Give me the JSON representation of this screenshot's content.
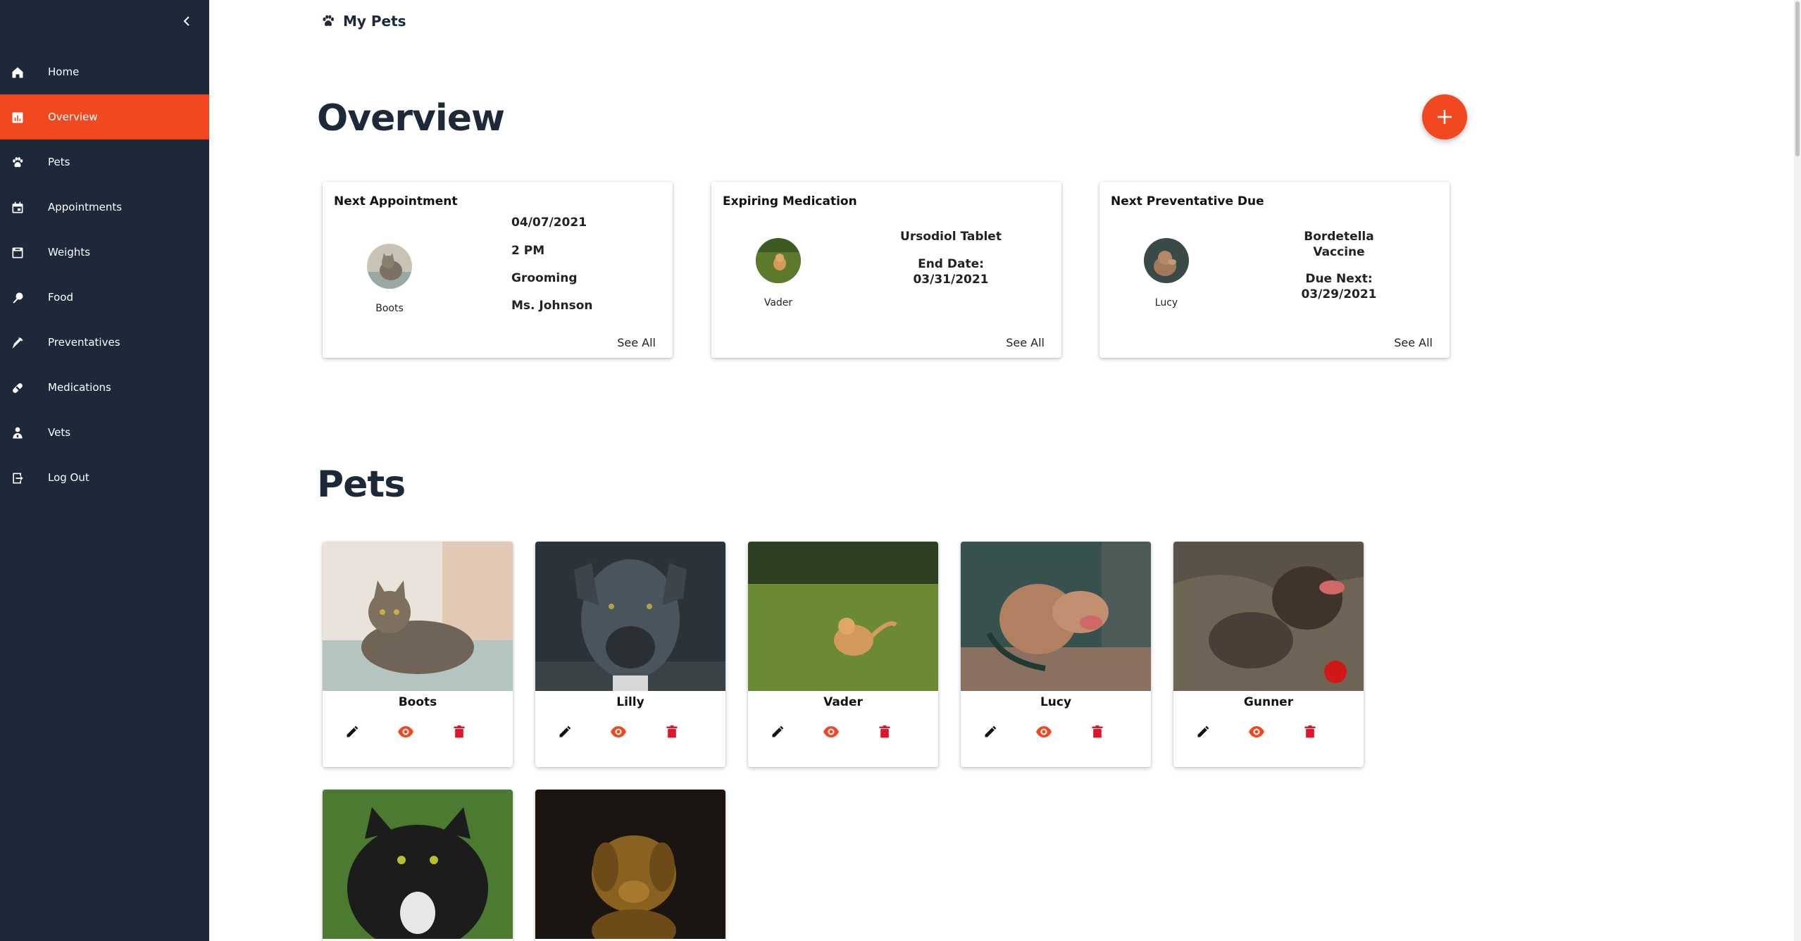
{
  "app": {
    "title": "My Pets"
  },
  "sidebar": {
    "items": [
      {
        "label": "Home",
        "icon": "home-icon",
        "active": false
      },
      {
        "label": "Overview",
        "icon": "chart-icon",
        "active": true
      },
      {
        "label": "Pets",
        "icon": "paw-icon",
        "active": false
      },
      {
        "label": "Appointments",
        "icon": "calendar-icon",
        "active": false
      },
      {
        "label": "Weights",
        "icon": "scale-icon",
        "active": false
      },
      {
        "label": "Food",
        "icon": "food-icon",
        "active": false
      },
      {
        "label": "Preventatives",
        "icon": "syringe-icon",
        "active": false
      },
      {
        "label": "Medications",
        "icon": "pill-icon",
        "active": false
      },
      {
        "label": "Vets",
        "icon": "vet-icon",
        "active": false
      },
      {
        "label": "Log Out",
        "icon": "logout-icon",
        "active": false
      }
    ]
  },
  "overview": {
    "title": "Overview",
    "cards": [
      {
        "title": "Next Appointment",
        "pet": "Boots",
        "date": "04/07/2021",
        "time": "2 PM",
        "type": "Grooming",
        "vet": "Ms. Johnson",
        "see_all": "See All"
      },
      {
        "title": "Expiring Medication",
        "pet": "Vader",
        "medication": "Ursodiol Tablet",
        "end_label": "End Date:",
        "end_date": "03/31/2021",
        "see_all": "See All"
      },
      {
        "title": "Next Preventative Due",
        "pet": "Lucy",
        "preventative_line1": "Bordetella",
        "preventative_line2": "Vaccine",
        "due_label": "Due Next:",
        "due_date": "03/29/2021",
        "see_all": "See All"
      }
    ]
  },
  "pets": {
    "title": "Pets",
    "items": [
      {
        "name": "Boots"
      },
      {
        "name": "Lilly"
      },
      {
        "name": "Vader"
      },
      {
        "name": "Lucy"
      },
      {
        "name": "Gunner"
      },
      {
        "name": ""
      },
      {
        "name": ""
      }
    ]
  },
  "colors": {
    "accent": "#f24822",
    "sidebar": "#1d2939",
    "delete": "#e0142a"
  }
}
